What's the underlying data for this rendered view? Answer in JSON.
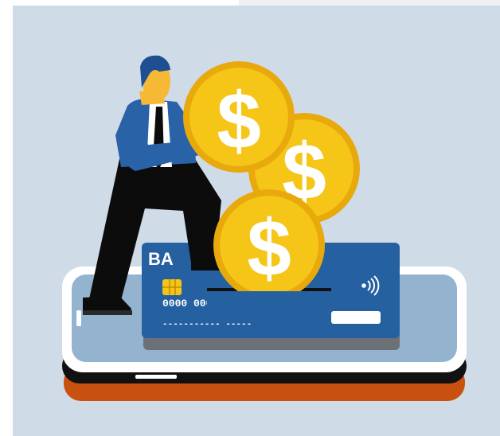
{
  "illustration": {
    "card": {
      "brand_text": "BA",
      "number_groups": "0000 0000 0000 0000",
      "name_placeholder": "----------- -----",
      "contactless_icon": "contactless-icon"
    },
    "coins": [
      {
        "symbol": "$"
      },
      {
        "symbol": "$"
      },
      {
        "symbol": "$"
      }
    ],
    "colors": {
      "background": "#cfdbe7",
      "phone_body": "#c8510f",
      "phone_screen": "#93b3cf",
      "card": "#2560a0",
      "coin": "#f5c518",
      "coin_rim": "#e8a90c",
      "suit": "#2a62a8",
      "pants": "#0c0c0c",
      "hair": "#1e4f91"
    }
  }
}
